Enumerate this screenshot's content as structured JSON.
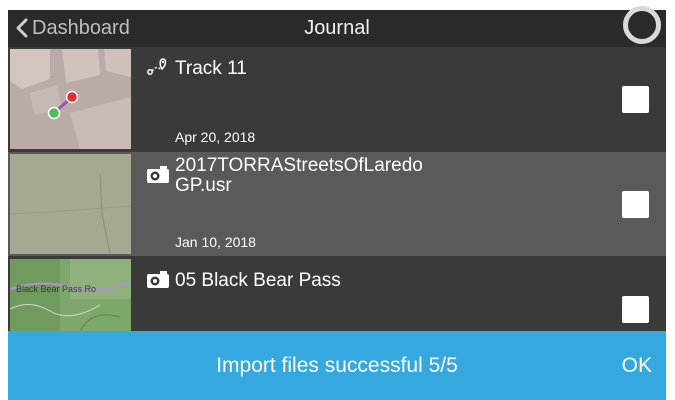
{
  "header": {
    "back_label": "Dashboard",
    "title": "Journal",
    "back_icon": "chevron-left-icon",
    "status_icon": "loading-ring-icon"
  },
  "rows": [
    {
      "type_icon": "track-route-icon",
      "name": "Track 11",
      "date": "Apr 20, 2018",
      "checked": false
    },
    {
      "type_icon": "camera-icon",
      "name": "2017TORRAStreetsOfLaredo\nGP.usr",
      "date": "Jan 10, 2018",
      "checked": false
    },
    {
      "type_icon": "camera-icon",
      "name": "05 Black Bear Pass",
      "map_label": "Black Bear Pass Ro",
      "checked": false
    }
  ],
  "toast": {
    "message": "Import files successful 5/5",
    "ok_label": "OK"
  },
  "colors": {
    "topbar": "#2a2a2a",
    "row_dark": "#3a3a3a",
    "row_highlight": "#5a5a5a",
    "toast": "#34a8df"
  }
}
